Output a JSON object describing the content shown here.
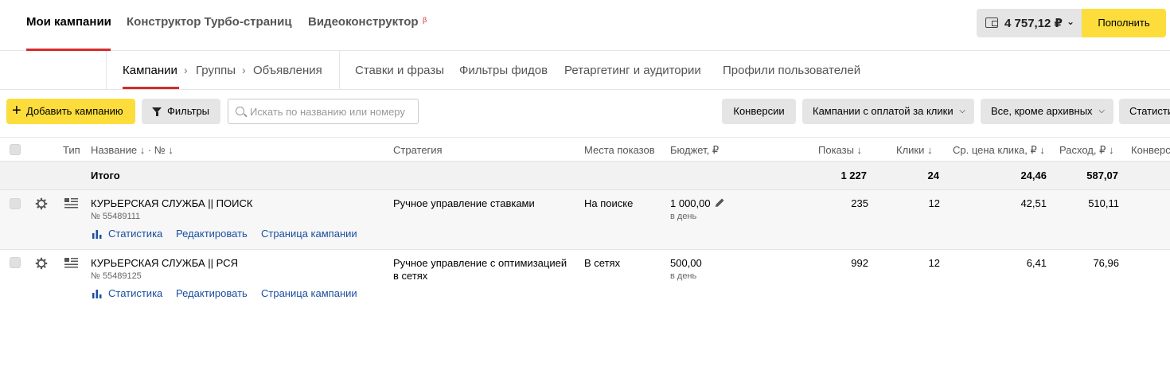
{
  "topnav": {
    "tabs": [
      "Мои кампании",
      "Конструктор Турбо-страниц",
      "Видеоконструктор"
    ],
    "beta": "β",
    "balance": "4 757,12 ₽",
    "topup_label": "Пополнить"
  },
  "subnav": {
    "breadcrumb": [
      "Кампании",
      "Группы",
      "Объявления"
    ],
    "items": [
      "Ставки и фразы",
      "Фильтры фидов",
      "Ретаргетинг и аудитории",
      "Профили пользователей"
    ]
  },
  "toolbar": {
    "add_label": "Добавить кампанию",
    "filters_label": "Фильтры",
    "search_placeholder": "Искать по названию или номеру",
    "conversions_label": "Конверсии",
    "campaign_type": "Кампании с оплатой за клики",
    "archive_filter": "Все, кроме архивных",
    "stats_label": "Статистика"
  },
  "table": {
    "headers": {
      "type": "Тип",
      "name": "Название ↓ · №  ↓",
      "strategy": "Стратегия",
      "placement": "Места показов",
      "budget": "Бюджет, ₽",
      "impressions": "Показы ↓",
      "clicks": "Клики ↓",
      "cpc": "Ср. цена клика, ₽ ↓",
      "spend": "Расход, ₽ ↓",
      "conversions": "Конверсии"
    },
    "total": {
      "label": "Итого",
      "impressions": "1 227",
      "clicks": "24",
      "cpc": "24,46",
      "spend": "587,07"
    },
    "rows": [
      {
        "name": "КУРЬЕРСКАЯ СЛУЖБА || ПОИСК",
        "number": "№ 55489111",
        "strategy_line1": "Ручное управление ставками",
        "strategy_line2": "",
        "placement": "На поиске",
        "budget": "1 000,00",
        "budget_period": "в день",
        "impressions": "235",
        "clicks": "12",
        "cpc": "42,51",
        "spend": "510,11",
        "links": [
          "Статистика",
          "Редактировать",
          "Страница кампании"
        ]
      },
      {
        "name": "КУРЬЕРСКАЯ СЛУЖБА || РСЯ",
        "number": "№ 55489125",
        "strategy_line1": "Ручное управление с оптимизацией",
        "strategy_line2": "в сетях",
        "placement": "В сетях",
        "budget": "500,00",
        "budget_period": "в день",
        "impressions": "992",
        "clicks": "12",
        "cpc": "6,41",
        "spend": "76,96",
        "links": [
          "Статистика",
          "Редактировать",
          "Страница кампании"
        ]
      }
    ]
  }
}
